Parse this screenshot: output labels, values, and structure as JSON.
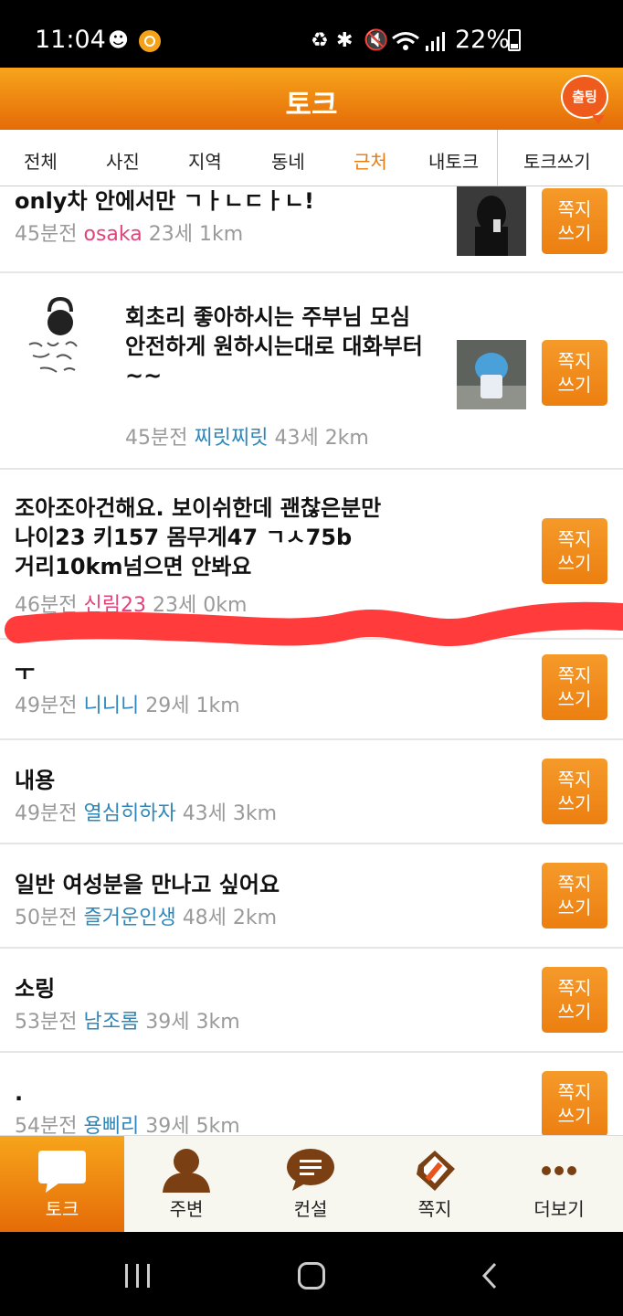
{
  "status_bar": {
    "time": "11:04",
    "battery": "22%",
    "icons": [
      "android-head-icon",
      "orange-circle-icon",
      "recycle-icon",
      "bluetooth-icon",
      "mute-icon",
      "wifi-icon",
      "signal-icon",
      "battery-icon"
    ]
  },
  "header": {
    "title": "토크",
    "logo_text": "출팅"
  },
  "tabs": [
    {
      "label": "전체"
    },
    {
      "label": "사진"
    },
    {
      "label": "지역"
    },
    {
      "label": "동네"
    },
    {
      "label": "근처",
      "active": true
    },
    {
      "label": "내토크"
    },
    {
      "label": "토크쓰기"
    }
  ],
  "posts": [
    {
      "title": "only차 안에서만 ㄱㅏㄴㄷㅏㄴ!",
      "time": "45분전",
      "nick": "osaka",
      "age": "23세",
      "dist": "1km",
      "button": [
        "쪽지",
        "쓰기"
      ]
    },
    {
      "title": "회초리 좋아하시는 주부님 모심\n안전하게 원하시는대로 대화부터~~",
      "time": "45분전",
      "nick": "찌릿찌릿",
      "age": "43세",
      "dist": "2km",
      "button": [
        "쪽지",
        "쓰기"
      ]
    },
    {
      "title": "조아조아건해요. 보이쉬한데 괜찮은분만\n나이23 키157 몸무게47 ㄱㅅ75b\n거리10km넘으면 안봐요",
      "time": "46분전",
      "nick": "신림23",
      "age": "23세",
      "dist": "0km",
      "button": [
        "쪽지",
        "쓰기"
      ]
    },
    {
      "title": "ㅜ",
      "time": "49분전",
      "nick": "니니니",
      "age": "29세",
      "dist": "1km",
      "button": [
        "쪽지",
        "쓰기"
      ]
    },
    {
      "title": "내용",
      "time": "49분전",
      "nick": "열심히하자",
      "age": "43세",
      "dist": "3km",
      "button": [
        "쪽지",
        "쓰기"
      ]
    },
    {
      "title": "일반 여성분을 만나고 싶어요",
      "time": "50분전",
      "nick": "즐거운인생",
      "age": "48세",
      "dist": "2km",
      "button": [
        "쪽지",
        "쓰기"
      ]
    },
    {
      "title": "소링",
      "time": "53분전",
      "nick": "남조롬",
      "age": "39세",
      "dist": "3km",
      "button": [
        "쪽지",
        "쓰기"
      ]
    },
    {
      "title": ".",
      "time": "54분전",
      "nick": "용삐리",
      "age": "39세",
      "dist": "5km",
      "button": [
        "쪽지",
        "쓰기"
      ]
    }
  ],
  "bottom_nav": [
    {
      "label": "토크",
      "icon": "chat-bubble-icon",
      "active": true
    },
    {
      "label": "주변",
      "icon": "person-icon"
    },
    {
      "label": "컨설",
      "icon": "consult-icon"
    },
    {
      "label": "쪽지",
      "icon": "note-icon"
    },
    {
      "label": "더보기",
      "icon": "more-icon"
    }
  ],
  "colors": {
    "accent": "#e67b10",
    "nick_blue": "#2f86b8",
    "nick_pink": "#e0447b",
    "scribble": "#ff3b3b"
  }
}
